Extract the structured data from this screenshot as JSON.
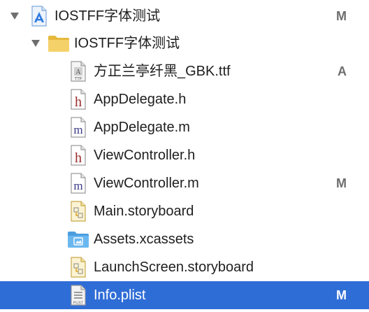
{
  "navigator": {
    "project": {
      "name": "IOSTFF字体测试",
      "status": "M",
      "icon": "xcode-project-icon",
      "expanded": true
    },
    "group": {
      "name": "IOSTFF字体测试",
      "icon": "folder-icon",
      "expanded": true
    },
    "files": [
      {
        "name": "方正兰亭纤黑_GBK.ttf",
        "status": "A",
        "icon": "ttf-file-icon",
        "icon_text": "TTF"
      },
      {
        "name": "AppDelegate.h",
        "status": "",
        "icon": "header-file-icon",
        "icon_text": "h"
      },
      {
        "name": "AppDelegate.m",
        "status": "",
        "icon": "objc-file-icon",
        "icon_text": "m"
      },
      {
        "name": "ViewController.h",
        "status": "",
        "icon": "header-file-icon",
        "icon_text": "h"
      },
      {
        "name": "ViewController.m",
        "status": "M",
        "icon": "objc-file-icon",
        "icon_text": "m"
      },
      {
        "name": "Main.storyboard",
        "status": "",
        "icon": "storyboard-file-icon",
        "icon_text": ""
      },
      {
        "name": "Assets.xcassets",
        "status": "",
        "icon": "asset-catalog-icon",
        "icon_text": ""
      },
      {
        "name": "LaunchScreen.storyboard",
        "status": "",
        "icon": "storyboard-file-icon",
        "icon_text": ""
      },
      {
        "name": "Info.plist",
        "status": "M",
        "icon": "plist-file-icon",
        "icon_text": "PLIST",
        "selected": true
      }
    ]
  },
  "colors": {
    "selection": "#2f6dd6",
    "status_text": "#6d6d6d",
    "folder": "#f5d16a",
    "folder_blue": "#6ab7f0",
    "header_letter": "#9b2a2a",
    "objc_letter": "#3a3a8a"
  }
}
